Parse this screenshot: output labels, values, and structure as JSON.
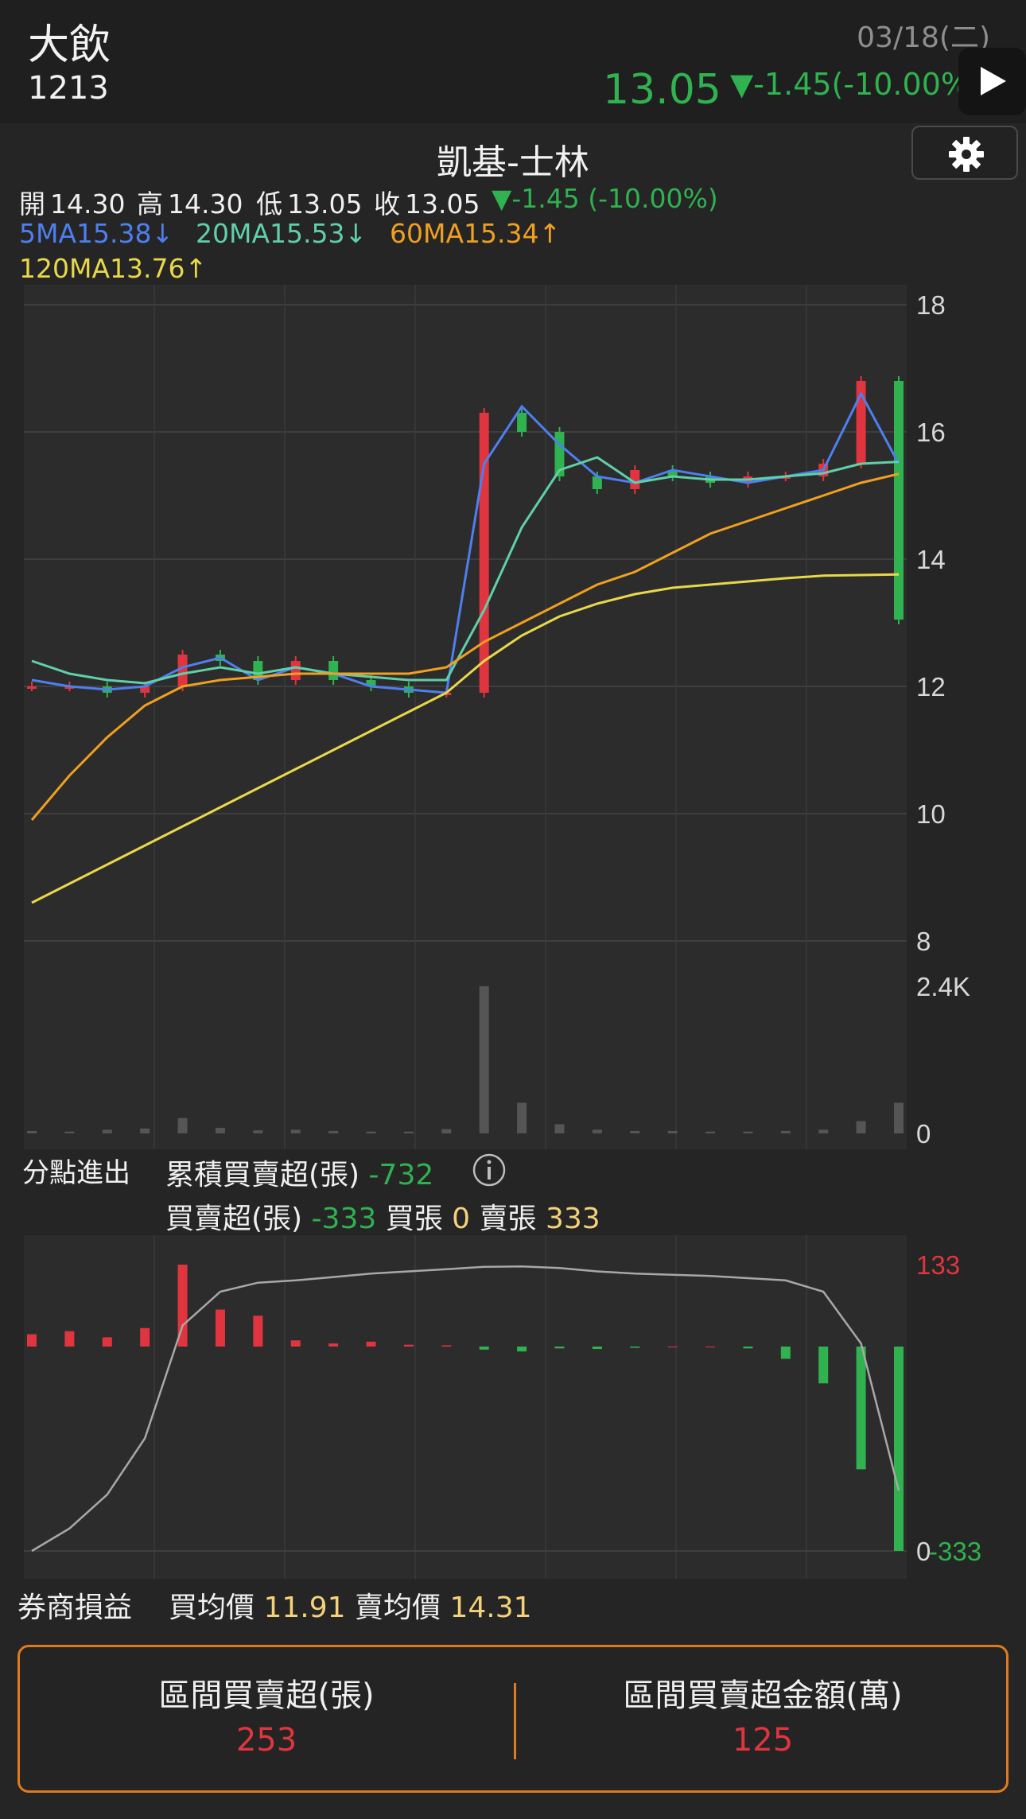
{
  "header": {
    "stock_name": "大飲",
    "stock_code": "1213",
    "date": "03/18(二)",
    "price": "13.05",
    "change": "▼-1.45(-10.00%)"
  },
  "broker": {
    "title": "凱基-士林"
  },
  "ohlc": {
    "open_label": "開",
    "open": "14.30",
    "high_label": "高",
    "high": "14.30",
    "low_label": "低",
    "low": "13.05",
    "close_label": "收",
    "close": "13.05",
    "change": "▼-1.45 (-10.00%)"
  },
  "ma": {
    "ma5": "5MA15.38↓",
    "ma20": "20MA15.53↓",
    "ma60": "60MA15.34↑",
    "ma120": "120MA13.76↑"
  },
  "flow": {
    "section_label": "分點進出",
    "cum_label": "累積買賣超(張)",
    "cum_value": "-732",
    "net_label": "買賣超(張)",
    "net_value": "-333",
    "buy_label": "買張",
    "buy_value": "0",
    "sell_label": "賣張",
    "sell_value": "333"
  },
  "pnl": {
    "label": "券商損益",
    "buy_avg_label": "買均價",
    "buy_avg": "11.91",
    "sell_avg_label": "賣均價",
    "sell_avg": "14.31"
  },
  "summary": {
    "net_title": "區間買賣超(張)",
    "net_value": "253",
    "amount_title": "區間買賣超金額(萬)",
    "amount_value": "125"
  },
  "colors": {
    "up": "#e0353f",
    "down": "#2fb24f",
    "ma5": "#4e7ff0",
    "ma20": "#5fd0a8",
    "ma60": "#f0a020",
    "ma120": "#e8d84a",
    "accent": "#e07a1f"
  },
  "chart_data": [
    {
      "type": "candlestick",
      "y_ticks": [
        "18",
        "16",
        "14",
        "12",
        "10",
        "8"
      ],
      "ylim": [
        8,
        18
      ],
      "grid": true,
      "series": [
        {
          "name": "5MA",
          "values": [
            12.1,
            12.0,
            11.95,
            12.0,
            12.3,
            12.45,
            12.1,
            12.3,
            12.2,
            12.0,
            11.95,
            11.9,
            15.5,
            16.4,
            15.8,
            15.3,
            15.2,
            15.4,
            15.3,
            15.2,
            15.3,
            15.4,
            16.6,
            15.5
          ]
        },
        {
          "name": "20MA",
          "values": [
            12.4,
            12.2,
            12.1,
            12.05,
            12.2,
            12.3,
            12.2,
            12.3,
            12.2,
            12.15,
            12.1,
            12.1,
            13.2,
            14.5,
            15.4,
            15.6,
            15.2,
            15.3,
            15.25,
            15.25,
            15.3,
            15.35,
            15.5,
            15.53
          ]
        },
        {
          "name": "60MA",
          "values": [
            9.9,
            10.6,
            11.2,
            11.7,
            12.0,
            12.1,
            12.15,
            12.2,
            12.2,
            12.2,
            12.2,
            12.3,
            12.7,
            13.0,
            13.3,
            13.6,
            13.8,
            14.1,
            14.4,
            14.6,
            14.8,
            15.0,
            15.2,
            15.34
          ]
        },
        {
          "name": "120MA",
          "values": [
            8.6,
            8.9,
            9.2,
            9.5,
            9.8,
            10.1,
            10.4,
            10.7,
            11.0,
            11.3,
            11.6,
            11.9,
            12.4,
            12.8,
            13.1,
            13.3,
            13.45,
            13.55,
            13.6,
            13.65,
            13.7,
            13.74,
            13.75,
            13.76
          ]
        }
      ],
      "close": [
        12.0,
        12.0,
        11.9,
        12.0,
        12.5,
        12.4,
        12.1,
        12.4,
        12.1,
        12.0,
        11.9,
        11.9,
        16.3,
        16.0,
        15.3,
        15.1,
        15.4,
        15.3,
        15.2,
        15.3,
        15.3,
        15.5,
        16.8,
        13.05
      ]
    },
    {
      "type": "bar",
      "name": "volume",
      "y_ticks": [
        "2.4K",
        "0"
      ],
      "ylim": [
        0,
        2400
      ],
      "values": [
        40,
        30,
        60,
        80,
        250,
        90,
        50,
        60,
        40,
        30,
        30,
        70,
        2400,
        500,
        150,
        60,
        40,
        40,
        30,
        30,
        40,
        60,
        200,
        500
      ]
    },
    {
      "type": "bar+line",
      "name": "broker flow",
      "y_ticks": [
        "133",
        "0",
        "-333"
      ],
      "net_values": [
        20,
        25,
        15,
        30,
        133,
        60,
        50,
        10,
        5,
        8,
        3,
        2,
        -5,
        -8,
        -3,
        -4,
        -2,
        0,
        0,
        -3,
        -20,
        -60,
        -200,
        -333
      ],
      "cumulative_values": [
        -1000,
        -900,
        -750,
        -500,
        0,
        150,
        190,
        200,
        215,
        230,
        240,
        250,
        260,
        262,
        255,
        240,
        230,
        225,
        220,
        210,
        200,
        150,
        -80,
        -732
      ]
    }
  ]
}
